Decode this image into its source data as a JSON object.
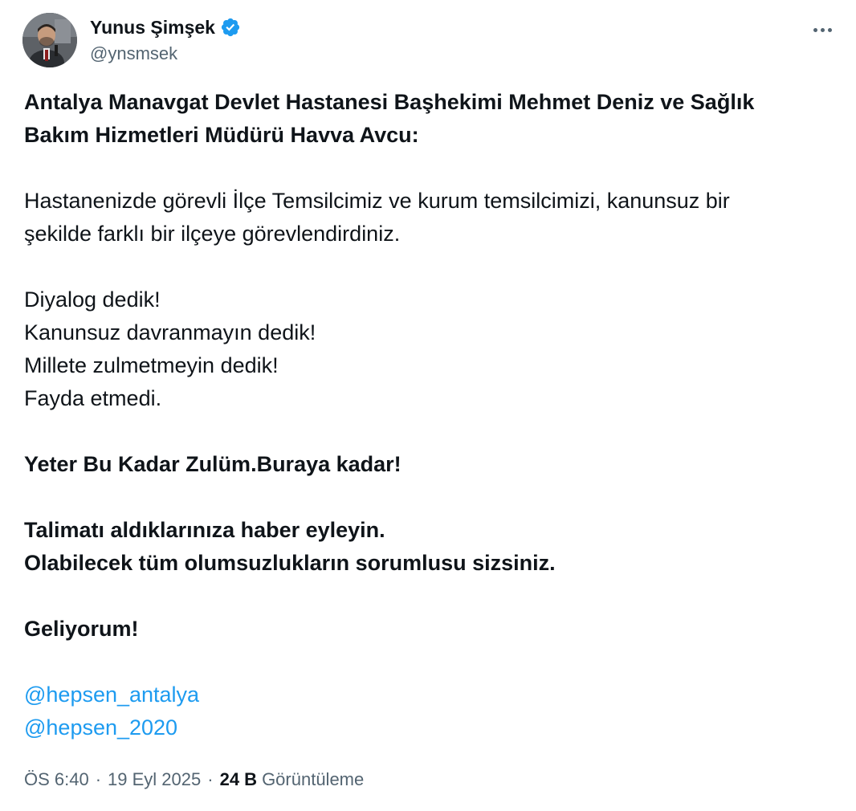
{
  "author": {
    "display_name": "Yunus Şimşek",
    "handle": "@ynsmsek",
    "verified": true,
    "avatar_icon": "profile-photo"
  },
  "tweet": {
    "heading_lines": [
      "Antalya Manavgat Devlet Hastanesi Başhekimi Mehmet Deniz ve Sağlık",
      "Bakım Hizmetleri Müdürü Havva Avcu:"
    ],
    "paragraph1": [
      "Hastanenizde görevli İlçe Temsilcimiz ve kurum temsilcimizi, kanunsuz bir",
      "şekilde farklı bir ilçeye görevlendirdiniz."
    ],
    "paragraph2": [
      "Diyalog dedik!",
      "Kanunsuz davranmayın dedik!",
      "Millete zulmetmeyin dedik!",
      "Fayda etmedi."
    ],
    "bold_line": "Yeter Bu Kadar Zulüm.Buraya kadar!",
    "bold_paragraph": [
      "Talimatı aldıklarınıza haber eyleyin.",
      "Olabilecek tüm olumsuzlukların sorumlusu sizsiniz."
    ],
    "closing": "Geliyorum!",
    "mentions": [
      "@hepsen_antalya",
      "@hepsen_2020"
    ]
  },
  "meta": {
    "time": "ÖS 6:40",
    "separator": "·",
    "date": "19 Eyl 2025",
    "views_count": "24 B",
    "views_label": "Görüntüleme"
  },
  "colors": {
    "text": "#0f1419",
    "secondary": "#536471",
    "link": "#1d9bf0",
    "verified": "#1d9bf0"
  }
}
